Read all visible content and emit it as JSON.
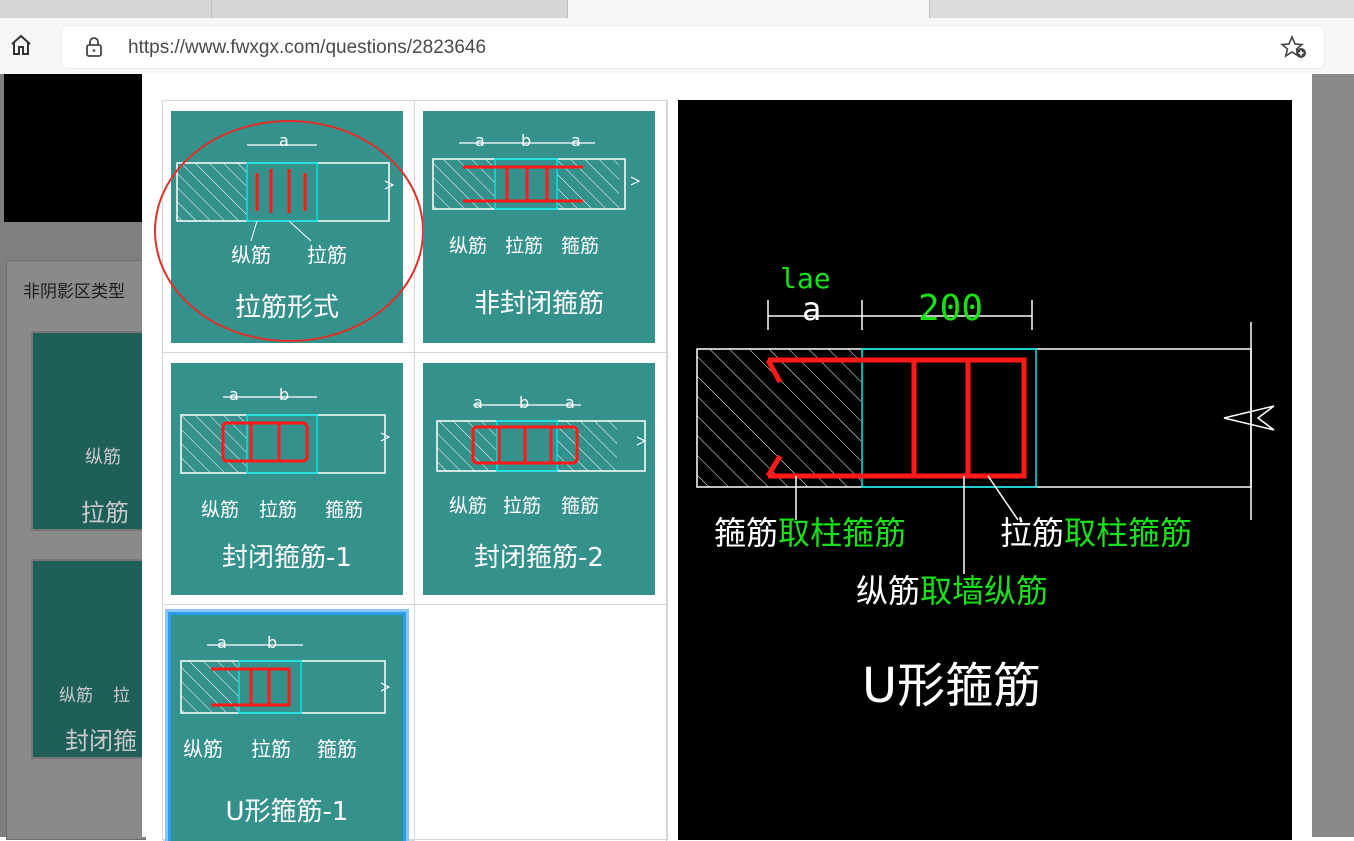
{
  "browser": {
    "url": "https://www.fwxgx.com/questions/2823646",
    "tabs": [
      {
        "label": ""
      },
      {
        "label": ""
      },
      {
        "label": ""
      }
    ]
  },
  "background": {
    "panel_label": "非阴影区类型",
    "cards": [
      {
        "labels": [
          "纵筋"
        ],
        "caption": "拉筋"
      },
      {
        "labels": [
          "纵筋",
          "拉"
        ],
        "caption": "封闭箍"
      }
    ]
  },
  "options": [
    {
      "caption": "拉筋形式",
      "labels": [
        "纵筋",
        "拉筋"
      ],
      "dims": [
        "a"
      ],
      "circled": true,
      "selected": false
    },
    {
      "caption": "非封闭箍筋",
      "labels": [
        "纵筋",
        "拉筋",
        "箍筋"
      ],
      "dims": [
        "a",
        "b",
        "a"
      ],
      "circled": false,
      "selected": false
    },
    {
      "caption": "封闭箍筋-1",
      "labels": [
        "纵筋",
        "拉筋",
        "箍筋"
      ],
      "dims": [
        "a",
        "b"
      ],
      "circled": false,
      "selected": false
    },
    {
      "caption": "封闭箍筋-2",
      "labels": [
        "纵筋",
        "拉筋",
        "箍筋"
      ],
      "dims": [
        "a",
        "b",
        "a"
      ],
      "circled": false,
      "selected": false
    },
    {
      "caption": "U形箍筋-1",
      "labels": [
        "纵筋",
        "拉筋",
        "箍筋"
      ],
      "dims": [
        "a",
        "b"
      ],
      "circled": false,
      "selected": true
    }
  ],
  "preview": {
    "dim_top": "lae",
    "dim_a": "a",
    "dim_b": "200",
    "label_left_white": "箍筋",
    "label_left_green": "取柱箍筋",
    "label_right_white": "拉筋",
    "label_right_green": "取柱箍筋",
    "label_mid_white": "纵筋",
    "label_mid_green": "取墙纵筋",
    "title": "U形箍筋"
  },
  "colors": {
    "card_bg": "#35918b",
    "rebar_red": "#ff1a1a",
    "cyan": "#00e5e5",
    "green_text": "#19e019",
    "selection_blue": "#2a9cf2",
    "annotation_circle": "#e0302a"
  }
}
